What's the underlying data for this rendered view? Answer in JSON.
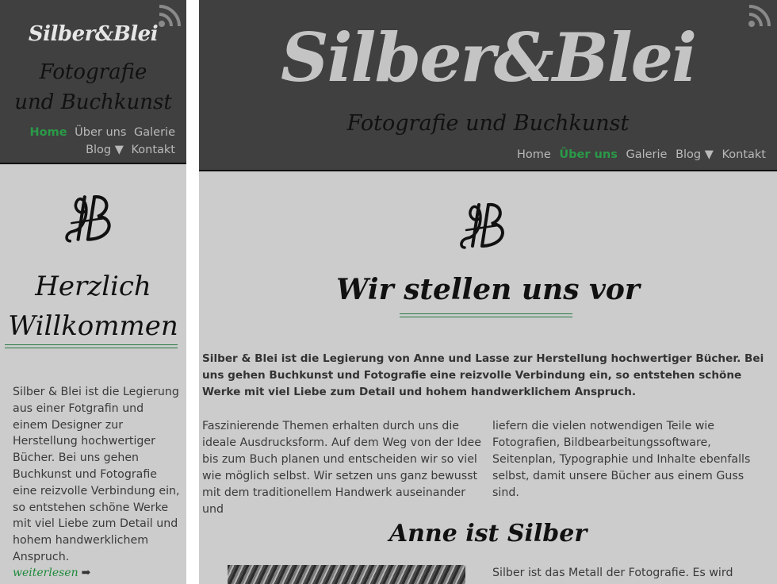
{
  "brand": {
    "name": "Silber&Blei",
    "tagline_line1": "Fotografie",
    "tagline_line2": "und Buchkunst",
    "tagline": "Fotografie und Buchkunst"
  },
  "icons": {
    "feed": "rss-feed-icon",
    "logo": "ab-monogram-icon",
    "more_arrow": "right-arrow-icon",
    "blog_dropdown": "triangle-down-icon"
  },
  "colors": {
    "header_bg": "#404040",
    "page_bg": "#cccccc",
    "accent_green": "#2a9a48",
    "nav_text": "#b9b9b9"
  },
  "mobile": {
    "nav": {
      "home": "Home",
      "about": "Über uns",
      "gallery": "Galerie",
      "blog": "Blog ▼",
      "contact": "Kontakt",
      "active": "Home"
    },
    "heading_line1": "Herzlich",
    "heading_line2": "Willkommen",
    "body": "Silber & Blei ist die Legierung aus einer Fotgrafin und einem Designer zur Herstellung hochwertiger Bücher. Bei uns gehen Buchkunst und Fotografie eine reizvolle Verbindung ein, so entstehen schöne Werke mit viel Liebe zum Detail und hohem handwerklichem Anspruch.",
    "read_more": "weiterlesen",
    "read_more_arrow": "➡"
  },
  "desktop": {
    "nav": {
      "home": "Home",
      "about": "Über uns",
      "gallery": "Galerie",
      "blog": "Blog ▼",
      "contact": "Kontakt",
      "active": "Über uns"
    },
    "heading": "Wir stellen uns vor",
    "lead": "Silber & Blei ist die Legierung von Anne und Lasse zur Herstellung hochwertiger Bücher. Bei uns gehen Buchkunst und Fotografie eine reizvolle Verbindung ein, so entstehen schöne Werke mit viel Liebe zum Detail und hohem handwerklichem Anspruch.",
    "col1": "Faszinierende Themen erhalten durch uns die ideale Ausdrucksform. Auf dem Weg von der Idee bis zum Buch planen und entscheiden wir so viel wie möglich selbst. Wir setzen uns ganz bewusst mit dem traditionellem Handwerk auseinander und",
    "col2": "liefern die vielen notwendigen Teile wie Fotografien, Bildbearbeitungssoftware, Seitenplan, Typographie und Inhalte ebenfalls selbst, damit unsere Bücher aus einem Guss sind.",
    "sub_heading": "Anne ist Silber",
    "sub_text": "Silber ist das Metall der Fotografie. Es wird"
  }
}
